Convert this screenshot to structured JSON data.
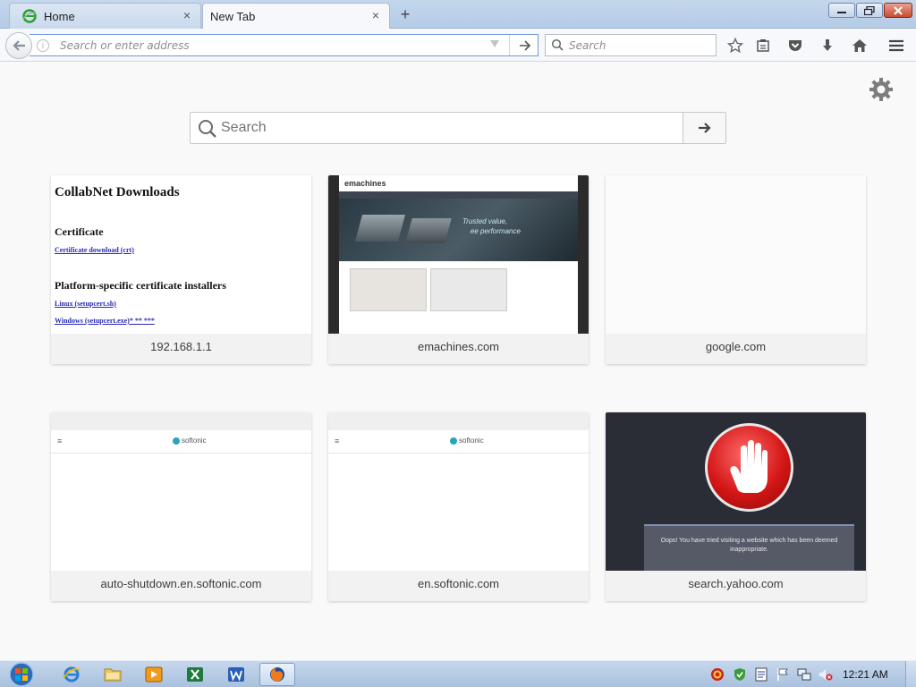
{
  "browser": {
    "tabs": [
      {
        "label": "Home",
        "favicon": "ie-e-icon",
        "active": false
      },
      {
        "label": "New Tab",
        "active": true
      }
    ],
    "new_tab_button": "+",
    "close_glyph": "×"
  },
  "navbar": {
    "url_placeholder": "Search or enter address",
    "search_placeholder": "Search"
  },
  "newtab": {
    "search_placeholder": "Search",
    "tiles": [
      {
        "title": "192.168.1.1"
      },
      {
        "title": "emachines.com"
      },
      {
        "title": "google.com"
      },
      {
        "title": "auto-shutdown.en.softonic.com"
      },
      {
        "title": "en.softonic.com"
      },
      {
        "title": "search.yahoo.com"
      }
    ]
  },
  "thumbnails": {
    "collabnet": {
      "heading": "CollabNet Downloads",
      "section1": "Certificate",
      "link1": "Certificate download (crt)",
      "section2": "Platform-specific certificate installers",
      "link2": "Linux (setupcert.sh)",
      "link3": "Windows (setupcert.exe)* ** ***"
    },
    "emachines": {
      "logo": "emachines",
      "hero_text_1": "Trusted value,",
      "hero_text_2": "ee performance"
    },
    "softonic": {
      "menu": "≡",
      "logo": "softonic"
    },
    "yahoo": {
      "message": "Oops! You have tried visiting a website which has been deemed inappropriate."
    }
  },
  "taskbar": {
    "clock": "12:21 AM"
  },
  "colors": {
    "tabstrip": "#b4cbe6",
    "urlbar_focus": "#6f9ad4",
    "taskbar": "#a9c1de",
    "stop_red": "#d41616"
  }
}
